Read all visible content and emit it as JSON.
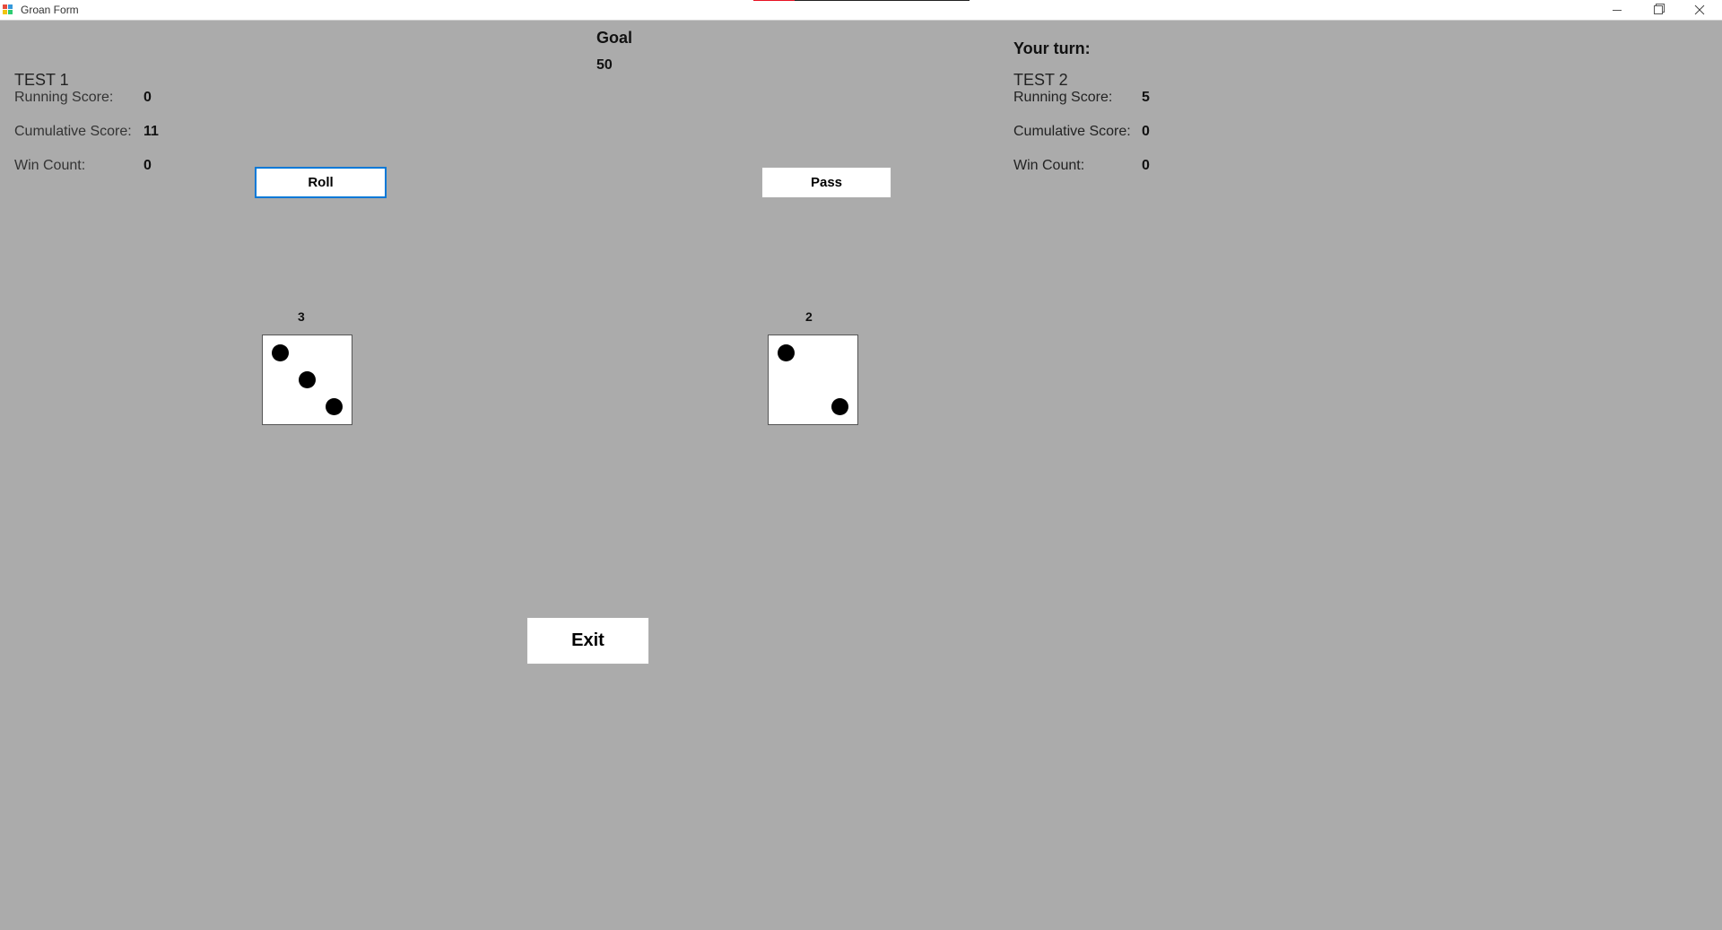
{
  "window": {
    "title": "Groan Form"
  },
  "goal": {
    "label": "Goal",
    "value": "50"
  },
  "turn": {
    "label": "Your turn:"
  },
  "player1": {
    "name": "TEST 1",
    "running_label": "Running Score:",
    "running_value": "0",
    "cumulative_label": "Cumulative Score:",
    "cumulative_value": "11",
    "wins_label": "Win Count:",
    "wins_value": "0"
  },
  "player2": {
    "name": "TEST 2",
    "running_label": "Running Score:",
    "running_value": "5",
    "cumulative_label": "Cumulative Score:",
    "cumulative_value": "0",
    "wins_label": "Win Count:",
    "wins_value": "0"
  },
  "buttons": {
    "roll": "Roll",
    "pass": "Pass",
    "exit": "Exit"
  },
  "dice": [
    {
      "label": "3",
      "value": 3
    },
    {
      "label": "2",
      "value": 2
    }
  ],
  "icons": {
    "minimize": "minimize-icon",
    "maximize": "restore-icon",
    "close": "close-icon",
    "app": "app-icon"
  }
}
